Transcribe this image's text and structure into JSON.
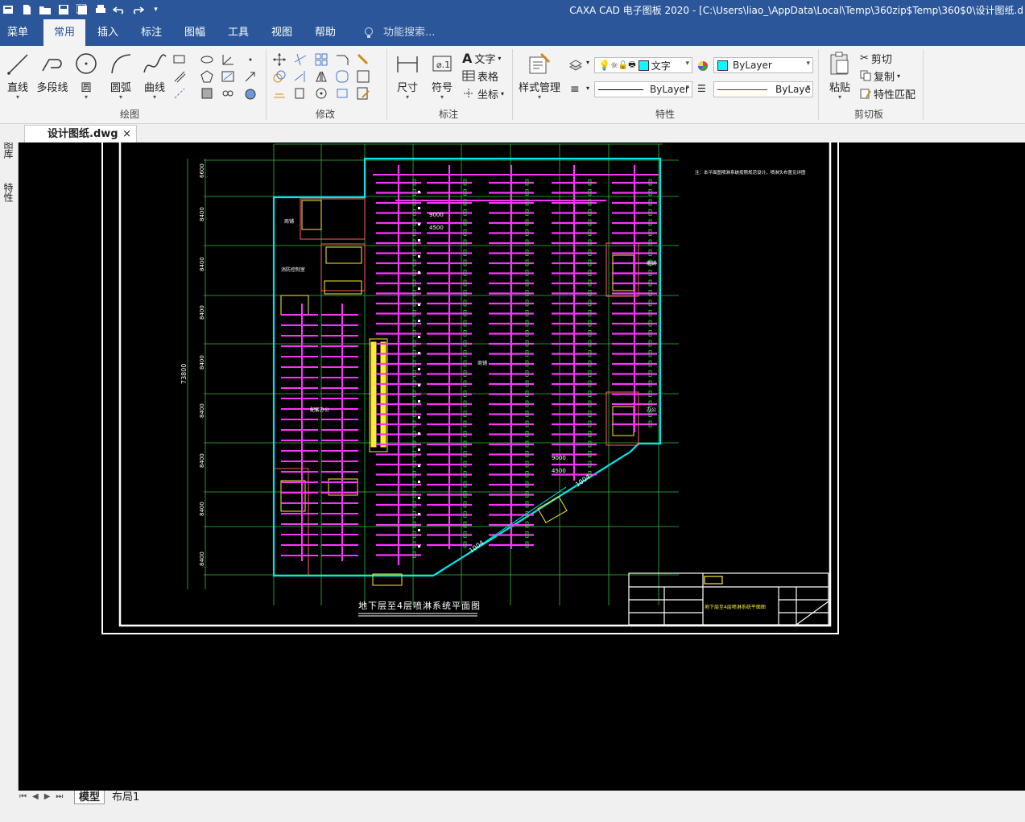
{
  "window": {
    "title": "CAXA CAD 电子图板 2020 - [C:\\Users\\liao_\\AppData\\Local\\Temp\\360zip$Temp\\360$0\\设计图纸.d"
  },
  "menu": {
    "tabs": [
      "菜单",
      "常用",
      "插入",
      "标注",
      "图幅",
      "工具",
      "视图",
      "帮助"
    ],
    "active": "常用",
    "search_placeholder": "功能搜索..."
  },
  "ribbon": {
    "draw": {
      "label": "绘图",
      "buttons": [
        "直线",
        "多段线",
        "圆",
        "圆弧",
        "曲线"
      ]
    },
    "modify": {
      "label": "修改"
    },
    "dimension": {
      "label": "标注",
      "buttons": [
        "尺寸",
        "符号"
      ],
      "small": [
        "文字",
        "表格",
        "坐标"
      ]
    },
    "properties": {
      "label": "特性",
      "style_manager": "样式管理",
      "layer_value": "文字",
      "color_value": "ByLayer",
      "linetype_value": "ByLayer",
      "lineweight_value": "ByLaye"
    },
    "clipboard": {
      "label": "剪切板",
      "paste": "粘贴",
      "small": [
        "剪切",
        "复制",
        "特性匹配"
      ]
    }
  },
  "document": {
    "tab_label": "设计图纸.dwg"
  },
  "side_tabs": [
    "图库",
    "特性"
  ],
  "drawing": {
    "title": "地下层至4层喷淋系统平面图",
    "note": "注：本平面图喷淋系统按照规范设计，喷淋头布置见详图",
    "dim_total": "73800",
    "dims_left": [
      "6600",
      "8400",
      "8400",
      "8400",
      "8400",
      "8400",
      "8400",
      "8400",
      "8400"
    ],
    "room_labels": [
      "商铺",
      "配套办公",
      "消防控制室",
      "商铺",
      "商铺",
      "办公"
    ],
    "dim_top": [
      "9000",
      "4500"
    ],
    "dim_bottom": [
      "9000",
      "4500"
    ],
    "slope_labels": [
      "1004",
      "1004"
    ],
    "title_block_name": "地下层至4层喷淋系统平面图"
  },
  "layouts": {
    "tabs": [
      "模型",
      "布局1"
    ],
    "active": "模型"
  }
}
